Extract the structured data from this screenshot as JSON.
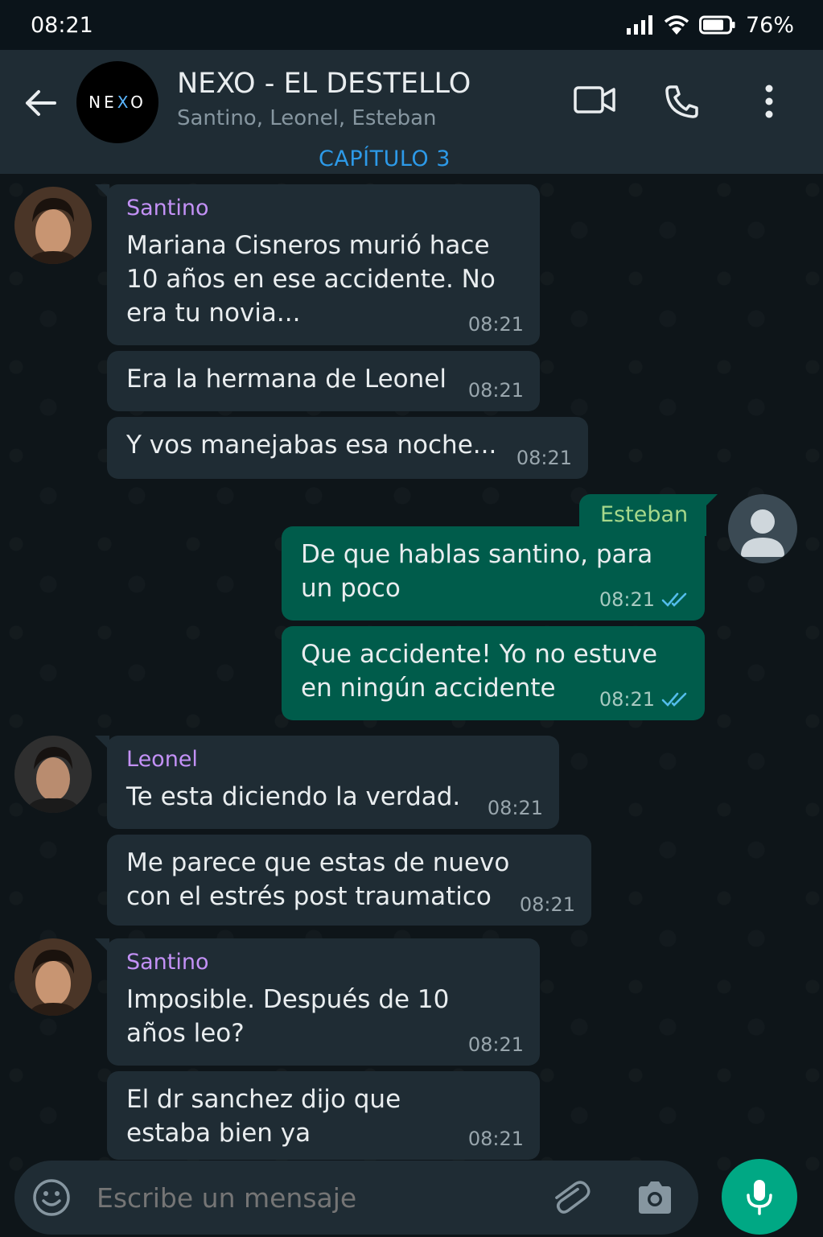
{
  "status_bar": {
    "time": "08:21",
    "battery": "76%"
  },
  "header": {
    "group_logo_pre": "NE",
    "group_logo_x": "X",
    "group_logo_post": "O",
    "title": "NEXO - EL DESTELLO",
    "members": "Santino, Leonel, Esteban",
    "chapter": "CAPÍTULO 3"
  },
  "messages": [
    {
      "sender": "Santino",
      "text": "Mariana Cisneros murió hace 10 años en ese accidente. No era tu novia...",
      "time": "08:21"
    },
    {
      "text": "Era la hermana de Leonel",
      "time": "08:21"
    },
    {
      "text": "Y vos manejabas esa noche...",
      "time": "08:21"
    },
    {
      "sender": "Esteban",
      "text": "De que hablas santino, para un poco",
      "time": "08:21",
      "status": "read"
    },
    {
      "text": "Que accidente! Yo no estuve en ningún accidente",
      "time": "08:21",
      "status": "read"
    },
    {
      "sender": "Leonel",
      "text": "Te esta diciendo la verdad.",
      "time": "08:21"
    },
    {
      "text": "Me parece que estas de nuevo con el estrés post traumatico",
      "time": "08:21"
    },
    {
      "sender": "Santino",
      "text": "Imposible. Después de 10 años leo?",
      "time": "08:21"
    },
    {
      "text": "El dr sanchez dijo que estaba bien ya",
      "time": "08:21"
    }
  ],
  "composer": {
    "placeholder": "Escribe un mensaje"
  },
  "colors": {
    "accent": "#00a884",
    "outgoing": "#005c4b",
    "incoming": "#1f2c34",
    "read_ticks": "#53bdeb",
    "chapter": "#2d9ae8"
  }
}
